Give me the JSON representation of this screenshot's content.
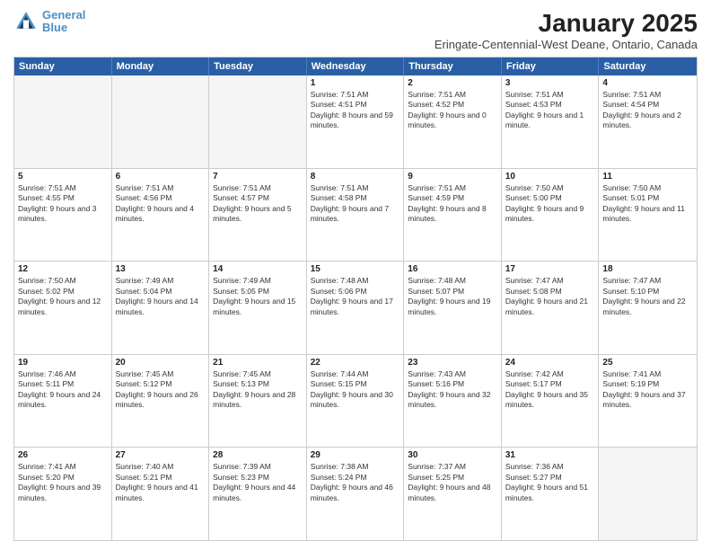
{
  "header": {
    "logo_line1": "General",
    "logo_line2": "Blue",
    "month": "January 2025",
    "location": "Eringate-Centennial-West Deane, Ontario, Canada"
  },
  "weekdays": [
    "Sunday",
    "Monday",
    "Tuesday",
    "Wednesday",
    "Thursday",
    "Friday",
    "Saturday"
  ],
  "rows": [
    [
      {
        "day": "",
        "empty": true
      },
      {
        "day": "",
        "empty": true
      },
      {
        "day": "",
        "empty": true
      },
      {
        "day": "1",
        "info": "Sunrise: 7:51 AM\nSunset: 4:51 PM\nDaylight: 8 hours and 59 minutes."
      },
      {
        "day": "2",
        "info": "Sunrise: 7:51 AM\nSunset: 4:52 PM\nDaylight: 9 hours and 0 minutes."
      },
      {
        "day": "3",
        "info": "Sunrise: 7:51 AM\nSunset: 4:53 PM\nDaylight: 9 hours and 1 minute."
      },
      {
        "day": "4",
        "info": "Sunrise: 7:51 AM\nSunset: 4:54 PM\nDaylight: 9 hours and 2 minutes."
      }
    ],
    [
      {
        "day": "5",
        "info": "Sunrise: 7:51 AM\nSunset: 4:55 PM\nDaylight: 9 hours and 3 minutes."
      },
      {
        "day": "6",
        "info": "Sunrise: 7:51 AM\nSunset: 4:56 PM\nDaylight: 9 hours and 4 minutes."
      },
      {
        "day": "7",
        "info": "Sunrise: 7:51 AM\nSunset: 4:57 PM\nDaylight: 9 hours and 5 minutes."
      },
      {
        "day": "8",
        "info": "Sunrise: 7:51 AM\nSunset: 4:58 PM\nDaylight: 9 hours and 7 minutes."
      },
      {
        "day": "9",
        "info": "Sunrise: 7:51 AM\nSunset: 4:59 PM\nDaylight: 9 hours and 8 minutes."
      },
      {
        "day": "10",
        "info": "Sunrise: 7:50 AM\nSunset: 5:00 PM\nDaylight: 9 hours and 9 minutes."
      },
      {
        "day": "11",
        "info": "Sunrise: 7:50 AM\nSunset: 5:01 PM\nDaylight: 9 hours and 11 minutes."
      }
    ],
    [
      {
        "day": "12",
        "info": "Sunrise: 7:50 AM\nSunset: 5:02 PM\nDaylight: 9 hours and 12 minutes."
      },
      {
        "day": "13",
        "info": "Sunrise: 7:49 AM\nSunset: 5:04 PM\nDaylight: 9 hours and 14 minutes."
      },
      {
        "day": "14",
        "info": "Sunrise: 7:49 AM\nSunset: 5:05 PM\nDaylight: 9 hours and 15 minutes."
      },
      {
        "day": "15",
        "info": "Sunrise: 7:48 AM\nSunset: 5:06 PM\nDaylight: 9 hours and 17 minutes."
      },
      {
        "day": "16",
        "info": "Sunrise: 7:48 AM\nSunset: 5:07 PM\nDaylight: 9 hours and 19 minutes."
      },
      {
        "day": "17",
        "info": "Sunrise: 7:47 AM\nSunset: 5:08 PM\nDaylight: 9 hours and 21 minutes."
      },
      {
        "day": "18",
        "info": "Sunrise: 7:47 AM\nSunset: 5:10 PM\nDaylight: 9 hours and 22 minutes."
      }
    ],
    [
      {
        "day": "19",
        "info": "Sunrise: 7:46 AM\nSunset: 5:11 PM\nDaylight: 9 hours and 24 minutes."
      },
      {
        "day": "20",
        "info": "Sunrise: 7:45 AM\nSunset: 5:12 PM\nDaylight: 9 hours and 26 minutes."
      },
      {
        "day": "21",
        "info": "Sunrise: 7:45 AM\nSunset: 5:13 PM\nDaylight: 9 hours and 28 minutes."
      },
      {
        "day": "22",
        "info": "Sunrise: 7:44 AM\nSunset: 5:15 PM\nDaylight: 9 hours and 30 minutes."
      },
      {
        "day": "23",
        "info": "Sunrise: 7:43 AM\nSunset: 5:16 PM\nDaylight: 9 hours and 32 minutes."
      },
      {
        "day": "24",
        "info": "Sunrise: 7:42 AM\nSunset: 5:17 PM\nDaylight: 9 hours and 35 minutes."
      },
      {
        "day": "25",
        "info": "Sunrise: 7:41 AM\nSunset: 5:19 PM\nDaylight: 9 hours and 37 minutes."
      }
    ],
    [
      {
        "day": "26",
        "info": "Sunrise: 7:41 AM\nSunset: 5:20 PM\nDaylight: 9 hours and 39 minutes."
      },
      {
        "day": "27",
        "info": "Sunrise: 7:40 AM\nSunset: 5:21 PM\nDaylight: 9 hours and 41 minutes."
      },
      {
        "day": "28",
        "info": "Sunrise: 7:39 AM\nSunset: 5:23 PM\nDaylight: 9 hours and 44 minutes."
      },
      {
        "day": "29",
        "info": "Sunrise: 7:38 AM\nSunset: 5:24 PM\nDaylight: 9 hours and 46 minutes."
      },
      {
        "day": "30",
        "info": "Sunrise: 7:37 AM\nSunset: 5:25 PM\nDaylight: 9 hours and 48 minutes."
      },
      {
        "day": "31",
        "info": "Sunrise: 7:36 AM\nSunset: 5:27 PM\nDaylight: 9 hours and 51 minutes."
      },
      {
        "day": "",
        "empty": true
      }
    ]
  ]
}
